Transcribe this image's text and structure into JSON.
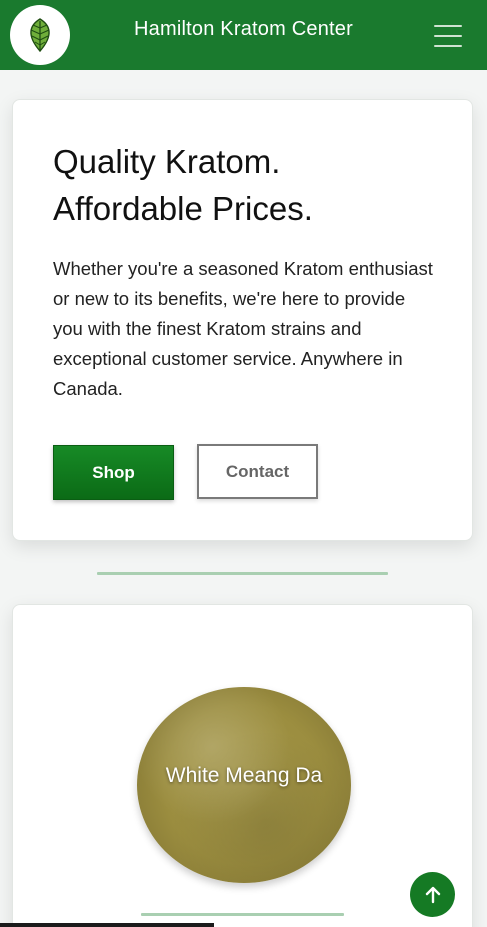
{
  "navbar": {
    "brand": "Hamilton Kratom Center",
    "logo_icon": "leaf-icon",
    "menu_icon": "hamburger-menu-icon",
    "color": "#1a7a2e"
  },
  "hero": {
    "title_line1": "Quality Kratom.",
    "title_line2": "Affordable Prices.",
    "text": "Whether you're a seasoned Kratom enthusiast or new to its benefits, we're here to provide you with the finest Kratom strains and exceptional customer service. Anywhere in Canada.",
    "shop_label": "Shop",
    "contact_label": "Contact"
  },
  "product": {
    "name": "White Meang Da",
    "image": "kratom-powder-image"
  },
  "back_to_top_icon": "arrow-up-icon"
}
